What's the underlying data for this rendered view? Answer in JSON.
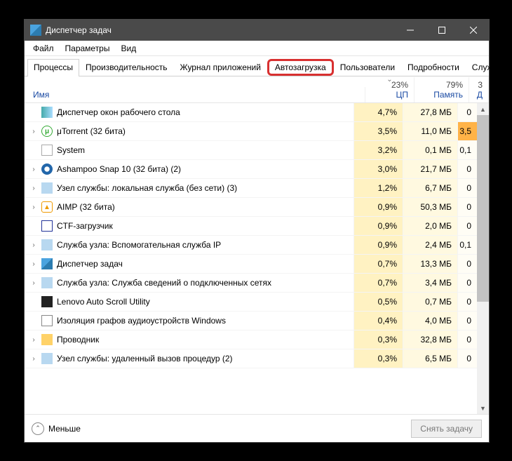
{
  "window": {
    "title": "Диспетчер задач"
  },
  "menu": {
    "file": "Файл",
    "options": "Параметры",
    "view": "Вид"
  },
  "tabs": {
    "processes": "Процессы",
    "performance": "Производительность",
    "apphistory": "Журнал приложений",
    "startup": "Автозагрузка",
    "users": "Пользователи",
    "details": "Подробности",
    "services": "Службы"
  },
  "columns": {
    "name": "Имя",
    "cpu_pct": "23%",
    "cpu_label": "ЦП",
    "mem_pct": "79%",
    "mem_label": "Память",
    "disk_pct": "3",
    "disk_label": "Д"
  },
  "rows": [
    {
      "name": "Диспетчер окон рабочего стола",
      "cpu": "4,7%",
      "mem": "27,8 МБ",
      "disk": "0",
      "icon": "ico-dwm",
      "exp": false
    },
    {
      "name": "μTorrent (32 бита)",
      "cpu": "3,5%",
      "mem": "11,0 МБ",
      "disk": "3,5",
      "diskHot": true,
      "icon": "ico-ut",
      "glyph": "μ",
      "exp": true
    },
    {
      "name": "System",
      "cpu": "3,2%",
      "mem": "0,1 МБ",
      "disk": "0,1",
      "icon": "ico-sys",
      "exp": false
    },
    {
      "name": "Ashampoo Snap 10 (32 бита) (2)",
      "cpu": "3,0%",
      "mem": "21,7 МБ",
      "disk": "0",
      "icon": "ico-ash",
      "exp": true
    },
    {
      "name": "Узел службы: локальная служба (без сети) (3)",
      "cpu": "1,2%",
      "mem": "6,7 МБ",
      "disk": "0",
      "icon": "ico-svc",
      "exp": true
    },
    {
      "name": "AIMP (32 бита)",
      "cpu": "0,9%",
      "mem": "50,3 МБ",
      "disk": "0",
      "icon": "ico-aimp",
      "glyph": "▲",
      "exp": true
    },
    {
      "name": "CTF-загрузчик",
      "cpu": "0,9%",
      "mem": "2,0 МБ",
      "disk": "0",
      "icon": "ico-ctf",
      "exp": false
    },
    {
      "name": "Служба узла: Вспомогательная служба IP",
      "cpu": "0,9%",
      "mem": "2,4 МБ",
      "disk": "0,1",
      "icon": "ico-svc",
      "exp": true
    },
    {
      "name": "Диспетчер задач",
      "cpu": "0,7%",
      "mem": "13,3 МБ",
      "disk": "0",
      "icon": "ico-tm",
      "exp": true
    },
    {
      "name": "Служба узла: Служба сведений о подключенных сетях",
      "cpu": "0,7%",
      "mem": "3,4 МБ",
      "disk": "0",
      "icon": "ico-svc",
      "exp": true
    },
    {
      "name": "Lenovo Auto Scroll Utility",
      "cpu": "0,5%",
      "mem": "0,7 МБ",
      "disk": "0",
      "icon": "ico-len",
      "exp": false
    },
    {
      "name": "Изоляция графов аудиоустройств Windows",
      "cpu": "0,4%",
      "mem": "4,0 МБ",
      "disk": "0",
      "icon": "ico-aud",
      "exp": false
    },
    {
      "name": "Проводник",
      "cpu": "0,3%",
      "mem": "32,8 МБ",
      "disk": "0",
      "icon": "ico-exp",
      "exp": true
    },
    {
      "name": "Узел службы: удаленный вызов процедур (2)",
      "cpu": "0,3%",
      "mem": "6,5 МБ",
      "disk": "0",
      "icon": "ico-svc",
      "exp": true
    }
  ],
  "footer": {
    "less": "Меньше",
    "end_task": "Снять задачу"
  }
}
